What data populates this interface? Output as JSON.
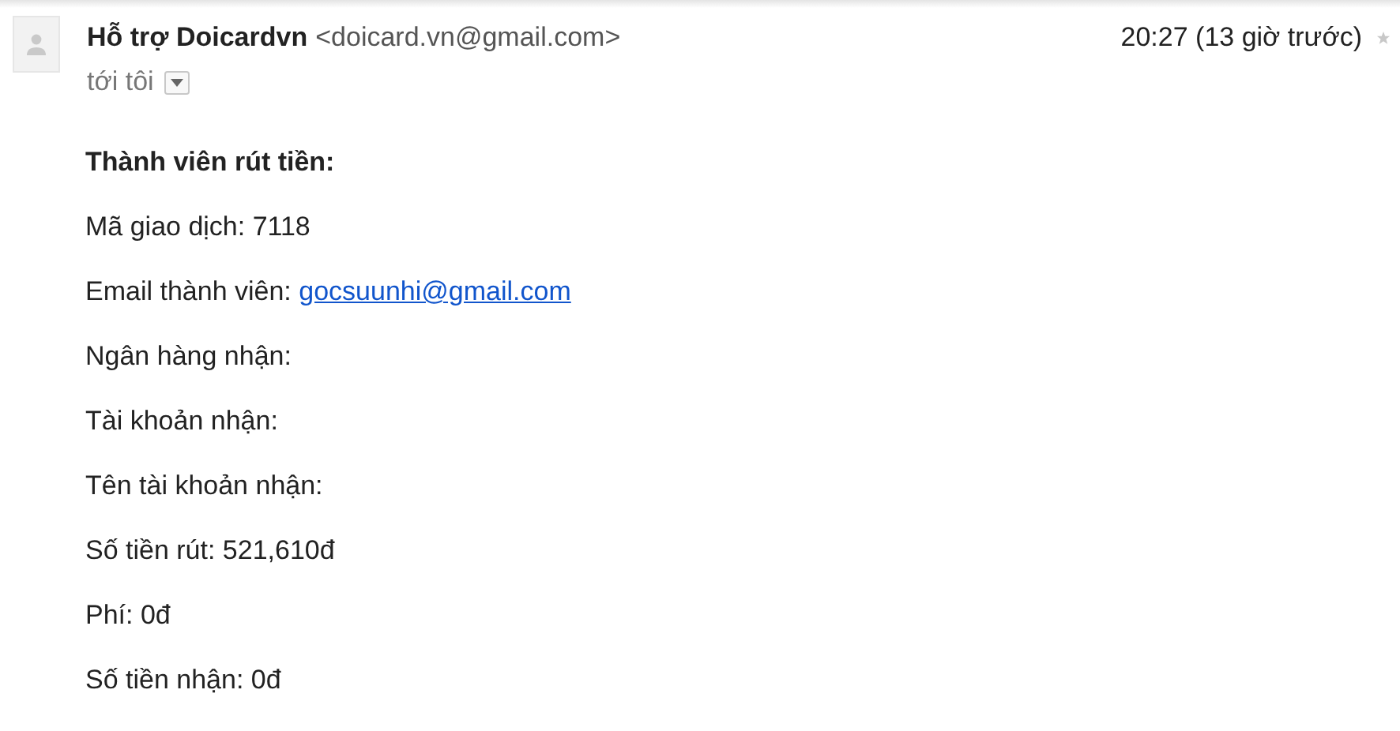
{
  "sender": {
    "name": "Hỗ trợ Doicardvn",
    "address": "<doicard.vn@gmail.com>"
  },
  "recipient": "tới tôi",
  "time": "20:27 (13 giờ trước)",
  "body": [
    {
      "kind": "heading",
      "text": "Thành viên rút tiền:"
    },
    {
      "kind": "text",
      "text": "Mã giao dịch: 7118"
    },
    {
      "kind": "link",
      "text": "Email thành viên: ",
      "link": "gocsuunhi@gmail.com"
    },
    {
      "kind": "text",
      "text": "Ngân hàng nhận:"
    },
    {
      "kind": "text",
      "text": "Tài khoản nhận:"
    },
    {
      "kind": "text",
      "text": "Tên tài khoản nhận:"
    },
    {
      "kind": "text",
      "text": "Số tiền rút: 521,610đ"
    },
    {
      "kind": "text",
      "text": "Phí: 0đ"
    },
    {
      "kind": "text",
      "text": "Số tiền nhận: 0đ"
    }
  ]
}
